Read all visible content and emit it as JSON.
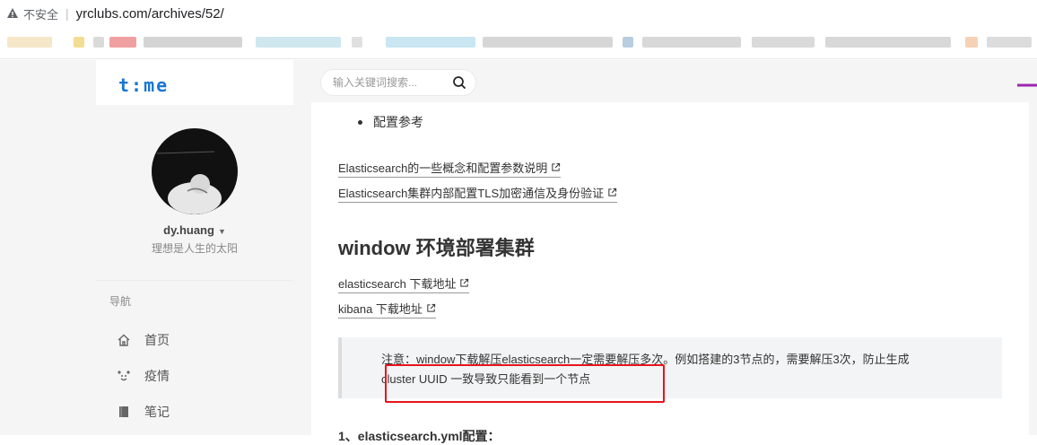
{
  "browser": {
    "insecure_label": "不安全",
    "separator": "|",
    "url": "yrclubs.com/archives/52/"
  },
  "site": {
    "logo": "t:me",
    "search_placeholder": "输入关键词搜索..."
  },
  "profile": {
    "username": "dy.huang",
    "motto": "理想是人生的太阳"
  },
  "nav": {
    "heading": "导航",
    "items": [
      {
        "label": "首页",
        "icon": "home-icon"
      },
      {
        "label": "疫情",
        "icon": "face-icon"
      },
      {
        "label": "笔记",
        "icon": "book-icon"
      }
    ]
  },
  "article": {
    "bullet": "配置参考",
    "links": [
      "Elasticsearch的一些概念和配置参数说明",
      "Elasticsearch集群内部配置TLS加密通信及身份验证"
    ],
    "heading": "window 环境部署集群",
    "download_links": [
      "elasticsearch 下载地址",
      "kibana 下载地址"
    ],
    "note_line1": "注意：window下载解压elasticsearch一定需要解压多次。例如搭建的3节点的，需要解压3次，防止生成",
    "note_line2": "cluster UUID 一致导致只能看到一个节点",
    "next_heading": "1、elasticsearch.yml配置："
  },
  "colors": {
    "logo": "#1976d2",
    "highlight_box": "#e8141b",
    "accent_arrow": "#9c27b0"
  }
}
